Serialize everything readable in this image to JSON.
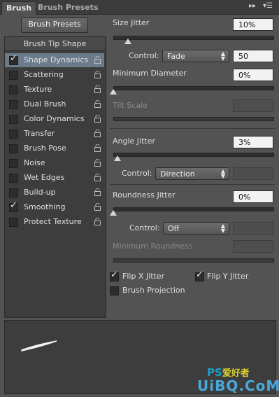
{
  "tabs": [
    "Brush",
    "Brush Presets"
  ],
  "brush_presets_button": "Brush Presets",
  "brush_tip_shape": "Brush Tip Shape",
  "options": [
    {
      "label": "Shape Dynamics",
      "checked": true,
      "selected": true
    },
    {
      "label": "Scattering",
      "checked": false
    },
    {
      "label": "Texture",
      "checked": false
    },
    {
      "label": "Dual Brush",
      "checked": false
    },
    {
      "label": "Color Dynamics",
      "checked": false
    },
    {
      "label": "Transfer",
      "checked": false
    },
    {
      "label": "Brush Pose",
      "checked": false
    },
    {
      "label": "Noise",
      "checked": false
    },
    {
      "label": "Wet Edges",
      "checked": false
    },
    {
      "label": "Build-up",
      "checked": false
    },
    {
      "label": "Smoothing",
      "checked": true
    },
    {
      "label": "Protect Texture",
      "checked": false
    }
  ],
  "size_jitter": {
    "label": "Size Jitter",
    "value": "10%"
  },
  "control1": {
    "label": "Control:",
    "value": "Fade",
    "number": "50"
  },
  "min_diameter": {
    "label": "Minimum Diameter",
    "value": "0%"
  },
  "tilt_scale": {
    "label": "Tilt Scale"
  },
  "angle_jitter": {
    "label": "Angle Jitter",
    "value": "3%"
  },
  "control2": {
    "label": "Control:",
    "value": "Direction"
  },
  "roundness_jitter": {
    "label": "Roundness Jitter",
    "value": "0%"
  },
  "control3": {
    "label": "Control:",
    "value": "Off"
  },
  "min_roundness": {
    "label": "Minimum Roundness"
  },
  "flip_x": {
    "label": "Flip X Jitter",
    "checked": true
  },
  "flip_y": {
    "label": "Flip Y Jitter",
    "checked": true
  },
  "brush_projection": {
    "label": "Brush Projection",
    "checked": false
  },
  "watermark": {
    "line1": "PS",
    "line1b": "爱好者",
    "line2": "UiBQ.CoM"
  }
}
